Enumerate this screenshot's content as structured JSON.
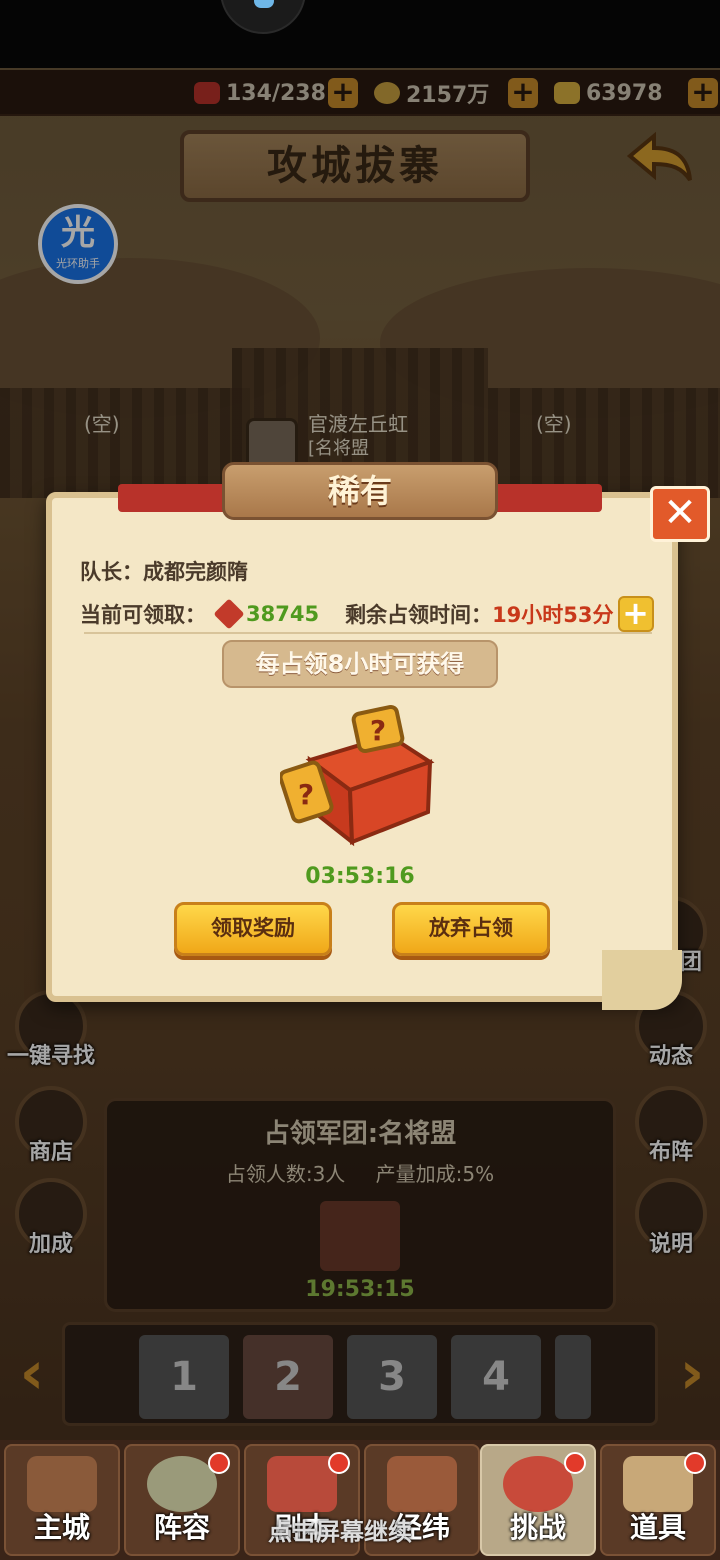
{
  "resources": [
    {
      "icon": "stamina-icon",
      "value": "134/238"
    },
    {
      "icon": "coin-icon",
      "value": "2157万"
    },
    {
      "icon": "ingot-icon",
      "value": "63978"
    }
  ],
  "header": {
    "title": "攻城拔寨",
    "back_icon": "back-arrow-icon"
  },
  "helper": {
    "glyph": "光",
    "label": "光环助手"
  },
  "map": {
    "left_slot": "(空)",
    "right_slot": "(空)",
    "occupant_name": "官渡左丘虹",
    "occupant_guild": "[名将盟"
  },
  "modal": {
    "title": "稀有",
    "captain_label": "队长：",
    "captain_name": "成都完颜隋",
    "claimable_label": "当前可领取：",
    "claimable_value": "38745",
    "remaining_label": "剩余占领时间：",
    "remaining_value": "19小时53分",
    "pill_text": "每占领8小时可获得",
    "countdown": "03:53:16",
    "claim_button": "领取奖励",
    "abandon_button": "放弃占领",
    "close_icon": "close-icon"
  },
  "side_left": [
    {
      "label": "一键寻找",
      "icon": "magnifier-icon"
    },
    {
      "label": "商店",
      "icon": "shop-icon"
    },
    {
      "label": "加成",
      "icon": "boost-icon"
    }
  ],
  "side_right": [
    {
      "label": "团",
      "icon": "team-icon"
    },
    {
      "label": "动态",
      "icon": "news-icon"
    },
    {
      "label": "布阵",
      "icon": "formation-icon"
    },
    {
      "label": "说明",
      "icon": "help-book-icon"
    }
  ],
  "info_panel": {
    "legion": "占领军团:名将盟",
    "count": "占领人数:3人",
    "bonus": "产量加成:5%",
    "timer": "19:53:15"
  },
  "pages": [
    "1",
    "2",
    "3",
    "4"
  ],
  "bottom_nav": [
    {
      "label": "主城",
      "badge": false
    },
    {
      "label": "阵容",
      "badge": true
    },
    {
      "label": "剧本",
      "badge": true
    },
    {
      "label": "经纬",
      "badge": false
    },
    {
      "label": "挑战",
      "badge": true
    },
    {
      "label": "道具",
      "badge": true
    }
  ],
  "screen_overlay": "点击屏幕继续"
}
